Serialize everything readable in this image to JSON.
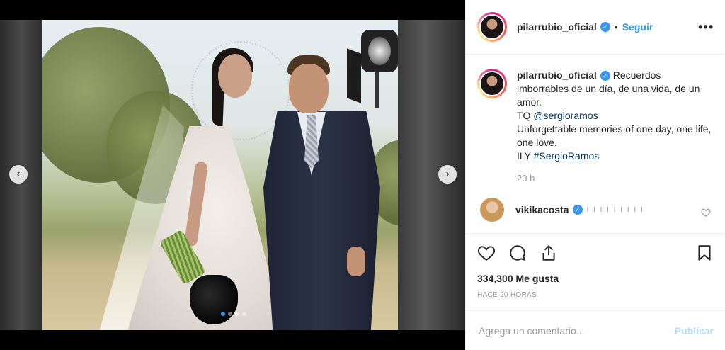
{
  "post": {
    "username": "pilarrubio_oficial",
    "separator": "•",
    "follow_label": "Seguir",
    "more_label": "•••",
    "caption": {
      "username": "pilarrubio_oficial",
      "line1": "Recuerdos imborrables de un día, de una vida, de un amor.",
      "tq_prefix": "TQ ",
      "mention": "@sergioramos",
      "line2": "Unforgettable memories of one day, one life, one love.",
      "ily_prefix": "ILY ",
      "hashtag": "#SergioRamos"
    },
    "caption_time": "20 h",
    "comments": [
      {
        "username": "vikikacosta",
        "text": "I I I I I I I I I"
      }
    ],
    "likes": "334,300 Me gusta",
    "posted_ago": "HACE 20 HORAS",
    "comment_placeholder": "Agrega un comentario...",
    "publish_label": "Publicar"
  },
  "carousel": {
    "prev_label": "‹",
    "next_label": "›",
    "dot_count": 4,
    "active_dot": 0
  },
  "colors": {
    "accent": "#3897f0",
    "publish_disabled": "#b2dffc",
    "link": "#003569"
  },
  "icons": {
    "verified": "verified-badge-icon",
    "like": "heart-icon",
    "comment": "comment-icon",
    "share": "share-icon",
    "save": "bookmark-icon"
  }
}
